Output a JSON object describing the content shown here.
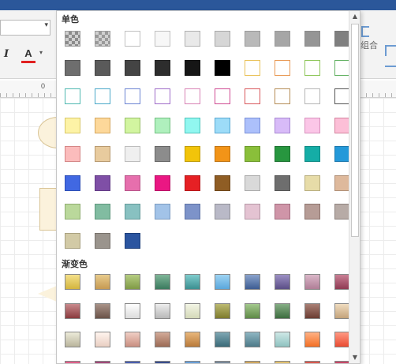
{
  "ribbon": {
    "italic_label": "I",
    "font_color_label": "A",
    "right_group_label": "组合"
  },
  "ruler": {
    "zero_label": "0"
  },
  "palette": {
    "solid_label": "单色",
    "gradient_label": "渐变色",
    "solid_rows": [
      [
        "pattern:#8c8c8c",
        "pattern:#9a9a9a",
        "#ffffff",
        "#f7f7f7",
        "#e9e9e9",
        "#d6d6d6",
        "#b9b9b9",
        "#a6a6a6",
        "#959595",
        "#7f7f7f"
      ],
      [
        "#6e6e6e",
        "#5a5a5a",
        "#444444",
        "#2d2d2d",
        "#161616",
        "#000000",
        "#ffffff",
        "#ffffff",
        "#ffffff",
        "#ffffff"
      ],
      [
        "#ffffff",
        "#ffffff",
        "#ffffff",
        "#ffffff",
        "#ffffff",
        "#ffffff",
        "#ffffff",
        "#ffffff",
        "#ffffff",
        "#ffffff"
      ],
      [
        "#fdf3a6",
        "#fdd89a",
        "#d2f5a0",
        "#aff0bd",
        "#91f7f0",
        "#9ddcf8",
        "#acc0fb",
        "#d8bbf8",
        "#fbc6e7",
        "#fcbfd7"
      ],
      [
        "#fbbcbc",
        "#e8cb9e",
        "#efefef",
        "#8c8c8c",
        "#f2c40a",
        "#f29418",
        "#8abf3a",
        "#27963f",
        "#15ada6",
        "#2499d9"
      ],
      [
        "#4168e2",
        "#7f4fa6",
        "#e66fad",
        "#ea1783",
        "#e62024",
        "#8f5d24",
        "#d9d9d9",
        "#6e6e6e",
        "#e7dca8",
        "#deb99c"
      ],
      [
        "#bad89b",
        "#81bca1",
        "#88c1c1",
        "#a2c3e8",
        "#7d93c9",
        "#b9b9c7",
        "#e4c3d2",
        "#cf95a8",
        "#b69c96",
        "#b7aba6"
      ],
      [
        "#d2caa6",
        "#9a948d",
        "#2b55a0"
      ]
    ],
    "solid_borders": [
      [
        "#9a9a9a",
        "#9a9a9a",
        "#c0c0c0",
        "#c0c0c0",
        "#b0b0b0",
        "#a8a8a8",
        "#9a9a9a",
        "#9a9a9a",
        "#8a8a8a",
        "#7a7a7a"
      ],
      [
        "#555555",
        "#444444",
        "#333333",
        "#222222",
        "#111111",
        "#000000",
        "#e9c25a",
        "#e89a55",
        "#8ec65a",
        "#63b163"
      ],
      [
        "#4fb8b0",
        "#4aa8c8",
        "#6c84d2",
        "#9f6cc8",
        "#d883b5",
        "#cf4c93",
        "#d8585c",
        "#b58d56",
        "#b5b5b5",
        "#555555"
      ],
      [
        "#d9c86a",
        "#d5a860",
        "#99c06a",
        "#72c082",
        "#4fc4bb",
        "#5aa8d2",
        "#7a8fd8",
        "#a888d2",
        "#d892bd",
        "#d5839e"
      ],
      [
        "#d58686",
        "#b89a70",
        "#bdbdbd",
        "#666666",
        "#c09c08",
        "#c07412",
        "#6b9a2a",
        "#1c7230",
        "#0f8a84",
        "#1c78ad"
      ],
      [
        "#2e4fb5",
        "#623b85",
        "#b85589",
        "#b81266",
        "#b5181b",
        "#6e461a",
        "#aaaaaa",
        "#555555",
        "#b8ae80",
        "#b09078"
      ],
      [
        "#90ad72",
        "#5f977d",
        "#659a9a",
        "#7c9bc0",
        "#5f73a5",
        "#929299",
        "#b598a6",
        "#a36f80",
        "#8d756f",
        "#8e837f"
      ],
      [
        "#a8a080",
        "#77716b",
        "#1e3f7a"
      ]
    ],
    "gradient_rows": [
      [
        "#d3b53e",
        "#c69a52",
        "#7f9a45",
        "#3a7a5e",
        "#3b8f90",
        "#5aa7dc",
        "#3d5c92",
        "#5b4e86",
        "#b07e97",
        "#8f3a53"
      ],
      [
        "#8a3a3e",
        "#6a5248",
        "#dcdcdc",
        "#b8b8b8",
        "#d4d9b8",
        "#7e7b2c",
        "#5f8a46",
        "#3d6d3f",
        "#6b3c32",
        "#c4a37a"
      ],
      [
        "#b9b49c",
        "#e9cfc2",
        "#c98e80",
        "#9b6a55",
        "#b97a3a",
        "#3a6a78",
        "#4d7a88",
        "#8ec2c0",
        "#f36f25",
        "#e94b32"
      ]
    ],
    "gradient_tops": [
      [
        "#f4e08a",
        "#e8cb8c",
        "#b6cd82",
        "#7fb698",
        "#7fcccd",
        "#9ed3f3",
        "#8aa3cc",
        "#9c90c4",
        "#dab7c8",
        "#c97f94"
      ],
      [
        "#c98a8d",
        "#a99388",
        "#ffffff",
        "#ededed",
        "#f3f5e5",
        "#bcba72",
        "#a4c98e",
        "#86ae86",
        "#a98075",
        "#efdcc0"
      ],
      [
        "#ecead9",
        "#fff4ee",
        "#f0cfc5",
        "#d3ab99",
        "#e8b77c",
        "#7fa7b3",
        "#8fb6c2",
        "#cfe8e6",
        "#ffb285",
        "#ff9a84"
      ]
    ]
  }
}
